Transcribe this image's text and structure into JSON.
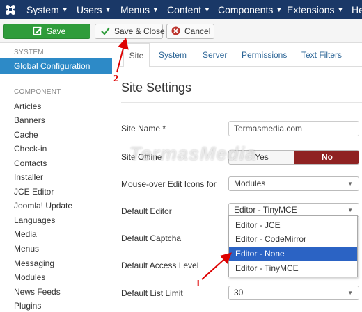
{
  "topnav": {
    "items": [
      {
        "label": "System"
      },
      {
        "label": "Users"
      },
      {
        "label": "Menus"
      },
      {
        "label": "Content"
      },
      {
        "label": "Components"
      },
      {
        "label": "Extensions"
      },
      {
        "label": "He"
      }
    ],
    "background": "#1a3867"
  },
  "toolbar": {
    "save_label": "Save",
    "save_close_label": "Save & Close",
    "cancel_label": "Cancel",
    "save_color": "#2f9c3b"
  },
  "sidebar": {
    "system_heading": "SYSTEM",
    "active_item": "Global Configuration",
    "component_heading": "COMPONENT",
    "items": [
      {
        "label": "Articles"
      },
      {
        "label": "Banners"
      },
      {
        "label": "Cache"
      },
      {
        "label": "Check-in"
      },
      {
        "label": "Contacts"
      },
      {
        "label": "Installer"
      },
      {
        "label": "JCE Editor"
      },
      {
        "label": "Joomla! Update"
      },
      {
        "label": "Languages"
      },
      {
        "label": "Media"
      },
      {
        "label": "Menus"
      },
      {
        "label": "Messaging"
      },
      {
        "label": "Modules"
      },
      {
        "label": "News Feeds"
      },
      {
        "label": "Plugins"
      }
    ],
    "active_color": "#2d8ac7"
  },
  "tabs": [
    {
      "label": "Site"
    },
    {
      "label": "System"
    },
    {
      "label": "Server"
    },
    {
      "label": "Permissions"
    },
    {
      "label": "Text Filters"
    }
  ],
  "section_title": "Site Settings",
  "form": {
    "site_name_label": "Site Name *",
    "site_name_value": "Termasmedia.com",
    "site_offline_label": "Site Offline",
    "site_offline_yes": "Yes",
    "site_offline_no": "No",
    "mouseover_label": "Mouse-over Edit Icons for",
    "mouseover_value": "Modules",
    "default_editor_label": "Default Editor",
    "default_editor_value": "Editor - TinyMCE",
    "default_captcha_label": "Default Captcha",
    "default_access_label": "Default Access Level",
    "default_list_limit_label": "Default List Limit",
    "default_list_limit_value": "30"
  },
  "editor_dropdown": {
    "options": [
      {
        "label": "Editor - JCE"
      },
      {
        "label": "Editor - CodeMirror"
      },
      {
        "label": "Editor - None"
      },
      {
        "label": "Editor - TinyMCE"
      }
    ],
    "highlighted": "Editor - None"
  },
  "watermark": "TermasMedia",
  "annotations": {
    "marker_1": "1",
    "marker_2": "2",
    "color": "#dd0000"
  }
}
